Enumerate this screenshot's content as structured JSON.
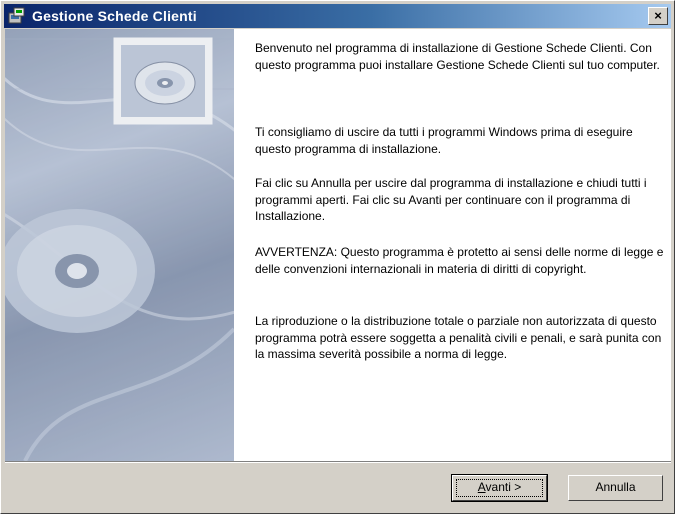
{
  "window": {
    "title": "Gestione Schede Clienti",
    "close_label": "×"
  },
  "content": {
    "paragraphs": [
      "Benvenuto nel programma di installazione di Gestione Schede Clienti. Con questo programma puoi installare Gestione Schede Clienti sul tuo computer.",
      "Ti consigliamo di uscire da tutti i programmi Windows prima di eseguire questo programma di installazione.",
      "Fai clic su Annulla per uscire dal programma di installazione e chiudi tutti i programmi aperti. Fai clic su Avanti per continuare con il programma di Installazione.",
      "AVVERTENZA: Questo programma è protetto ai sensi delle norme di legge e delle convenzioni internazionali in materia di diritti di copyright.",
      "La riproduzione o la distribuzione totale o parziale non autorizzata di questo programma potrà essere soggetta a penalità civili e penali, e sarà punita con la massima severità possibile a norma di legge."
    ]
  },
  "buttons": {
    "next_label_accel": "A",
    "next_label_rest": "vanti >",
    "cancel_label": "Annulla"
  },
  "icons": {
    "app": "setup-icon",
    "cd": "cd-disc-icon"
  },
  "colors": {
    "titlebar_start": "#0a246a",
    "titlebar_end": "#a6caf0",
    "face": "#d4d0c8"
  }
}
